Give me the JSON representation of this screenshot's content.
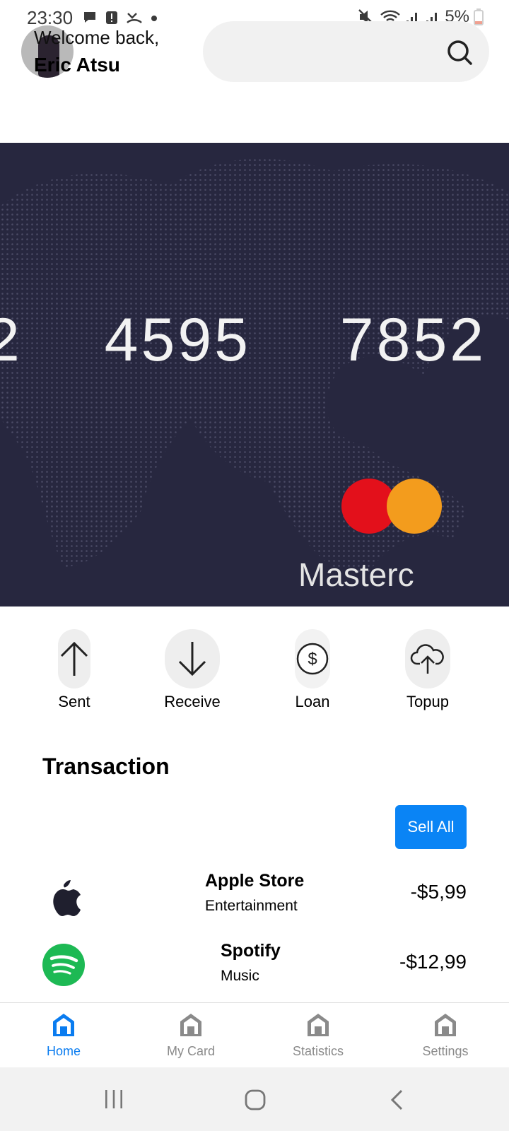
{
  "status_bar": {
    "time": "23:30",
    "left_icons": [
      "message-icon",
      "alert-icon",
      "call-missed-icon",
      "dot-icon"
    ],
    "right_icons": [
      "mute-icon",
      "wifi-icon",
      "signal-icon",
      "signal-icon",
      "battery-icon"
    ],
    "battery": "5%"
  },
  "header": {
    "welcome": "Welcome back,",
    "name": "Eric Atsu",
    "search_icon": "search-icon"
  },
  "card": {
    "number_groups": [
      "2",
      "4595",
      "7852"
    ],
    "brand": "Masterc",
    "brand_colors": {
      "left": "#e3101b",
      "right": "#f39c1d"
    },
    "background": "#27273f"
  },
  "actions": [
    {
      "label": "Sent",
      "icon": "arrow-up-icon"
    },
    {
      "label": "Receive",
      "icon": "arrow-down-icon"
    },
    {
      "label": "Loan",
      "icon": "dollar-icon"
    },
    {
      "label": "Topup",
      "icon": "cloud-upload-icon"
    }
  ],
  "transactions": {
    "title": "Transaction",
    "sell_all": "Sell All",
    "items": [
      {
        "name": "Apple Store",
        "category": "Entertainment",
        "amount": "-$5,99",
        "icon": "apple-logo-icon"
      },
      {
        "name": "Spotify",
        "category": "Music",
        "amount": "-$12,99",
        "icon": "spotify-logo-icon"
      }
    ]
  },
  "bottom_nav": [
    {
      "label": "Home",
      "icon": "home-icon",
      "active": true
    },
    {
      "label": "My Card",
      "icon": "home-icon",
      "active": false
    },
    {
      "label": "Statistics",
      "icon": "home-icon",
      "active": false
    },
    {
      "label": "Settings",
      "icon": "home-icon",
      "active": false
    }
  ],
  "theme": {
    "accent": "#0a84f5",
    "inactive": "#8a8a8a"
  }
}
